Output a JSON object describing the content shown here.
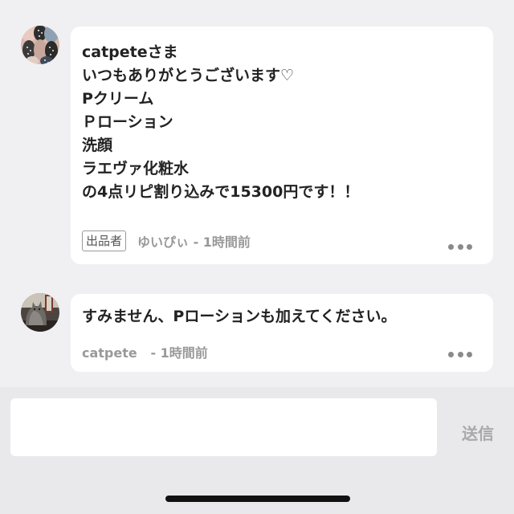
{
  "comments": [
    {
      "avatar_icon": "patterned-fabric-avatar-icon",
      "lines": [
        "catpeteさま",
        "いつもありがとうございます♡",
        "Pクリーム",
        "Ｐローション",
        "洗顔",
        "ラエヴァ化粧水",
        "の4点リピ割り込みで15300円です！！"
      ],
      "badge": "出品者",
      "meta": "ゆいぴぃ - 1時間前"
    },
    {
      "avatar_icon": "cat-photo-avatar-icon",
      "lines": [
        "すみません、Pローションも加えてください。"
      ],
      "meta": "catpete   - 1時間前"
    }
  ],
  "reply": {
    "value": "",
    "placeholder": "",
    "send_label": "送信"
  },
  "icons": {
    "more": "more-dots-icon"
  },
  "colors": {
    "background": "#f0f0f2",
    "card": "#ffffff",
    "text": "#222222",
    "meta": "#999999",
    "send_disabled": "#a9a9ad"
  }
}
